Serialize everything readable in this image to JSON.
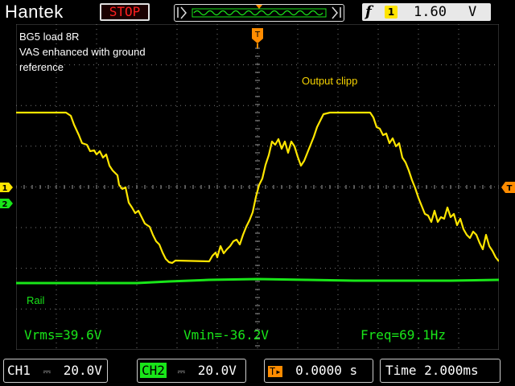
{
  "top": {
    "brand": "Hantek",
    "run_state": "STOP",
    "trigger_level": "1.60",
    "trigger_unit": "V",
    "trigger_channel": "1",
    "trigger_icon": "f"
  },
  "annotations": {
    "line1": "BG5 load 8R",
    "line2": "VAS enhanced with ground",
    "line3": "reference",
    "clip": "Output clipp",
    "rail": "Rail"
  },
  "measurements": {
    "vrms": "Vrms=39.6V",
    "vmin": "Vmin=-36.2V",
    "freq": "Freq=69.1Hz"
  },
  "bottom": {
    "ch1_label": "CH1",
    "ch1_scale": "20.0V",
    "ch2_label": "CH2",
    "ch2_scale": "20.0V",
    "trigger_pos": "0.0000 s",
    "timebase": "Time 2.000ms"
  },
  "markers": {
    "ch1": "1",
    "ch2": "2",
    "trigger": "T"
  },
  "colors": {
    "ch1": "#ffe600",
    "ch2": "#19e619",
    "text_ann": "#f5d200",
    "rail_text": "#19e619",
    "stop": "#ff2020"
  }
}
